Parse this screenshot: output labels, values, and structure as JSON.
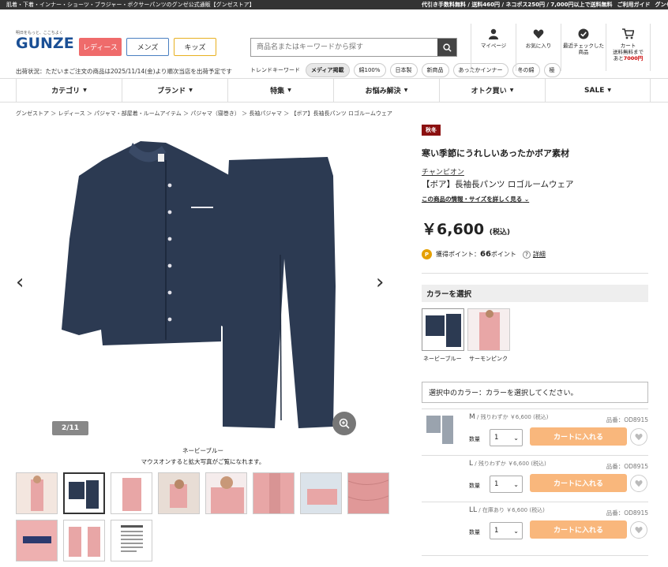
{
  "topbar": {
    "left": "肌着・下着・インナー・ショーツ・ブラジャー・ボクサーパンツのグンゼ公式通販【グンゼストア】",
    "links": [
      "代引き手数料無料 / 送料460円 / ネコポス250円 / 7,000円以上で送料無料",
      "ご利用ガイド",
      "グンゼ品質のこだわり"
    ]
  },
  "header": {
    "logo_tagline": "明日をもっと、ここちよく",
    "logo_name": "GUNZE",
    "gender_buttons": [
      "レディース",
      "メンズ",
      "キッズ"
    ],
    "shipping_notice": "出荷状況：ただいまご注文の商品は2025/11/14(金)より順次当店を出荷予定です",
    "search_placeholder": "商品名またはキーワードから探す",
    "trend_label": "トレンドキーワード",
    "trend_keywords": [
      "メディア掲載",
      "綿100%",
      "日本製",
      "新商品",
      "あったかインナー",
      "冬の綿",
      "極"
    ],
    "icons": [
      {
        "icon": "user-icon",
        "label": "マイページ"
      },
      {
        "icon": "heart-icon",
        "label": "お気に入り"
      },
      {
        "icon": "check-icon",
        "label": "最近チェックした商品"
      },
      {
        "icon": "cart-icon",
        "label": "カート",
        "note_a": "送料無料まで",
        "note_b": "あと",
        "note_amount": "7000円"
      }
    ]
  },
  "nav": [
    "カテゴリ",
    "ブランド",
    "特集",
    "お悩み解決",
    "オトク買い",
    "SALE"
  ],
  "breadcrumb": "グンゼストア ＞ レディース ＞ パジャマ・部屋着・ルームアイテム ＞ パジャマ（寝巻き） ＞ 長袖パジャマ ＞ 【ボア】長袖長パンツ ロゴルームウェア",
  "gallery": {
    "counter": "2/11",
    "color_caption": "ネービーブルー",
    "hint": "マウスオンすると拡大写真がご覧になれます。",
    "colors": {
      "navy": "#2c3a52",
      "pink": "#e8a6a6"
    }
  },
  "product": {
    "season_badge": "秋冬",
    "tagline": "寒い季節にうれしいあったかボア素材",
    "brand": "チャンピオン",
    "name": "【ボア】長袖長パンツ ロゴルームウェア",
    "info_link": "この商品の情報・サイズを詳しく見る",
    "price": "￥6,600",
    "tax": "(税込)",
    "points_label": "獲得ポイント：",
    "points_value": "66",
    "points_unit": "ポイント",
    "points_detail": "詳細",
    "color_header": "カラーを選択",
    "swatches": [
      "ネービーブルー",
      "サーモンピンク"
    ],
    "selected_color_text": "選択中のカラー：カラーを選択してください。",
    "rows": [
      {
        "size": "M",
        "stock": "残りわずか",
        "price": "￥6,600 (税込)",
        "code": "品番：OD8915",
        "qty_label": "数量",
        "qty": "1",
        "cart": "カートに入れる"
      },
      {
        "size": "L",
        "stock": "残りわずか",
        "price": "￥6,600 (税込)",
        "code": "品番：OD8915",
        "qty_label": "数量",
        "qty": "1",
        "cart": "カートに入れる"
      },
      {
        "size": "LL",
        "stock": "在庫あり",
        "price": "￥6,600 (税込)",
        "code": "品番：OD8915",
        "qty_label": "数量",
        "qty": "1",
        "cart": "カートに入れる"
      }
    ]
  }
}
